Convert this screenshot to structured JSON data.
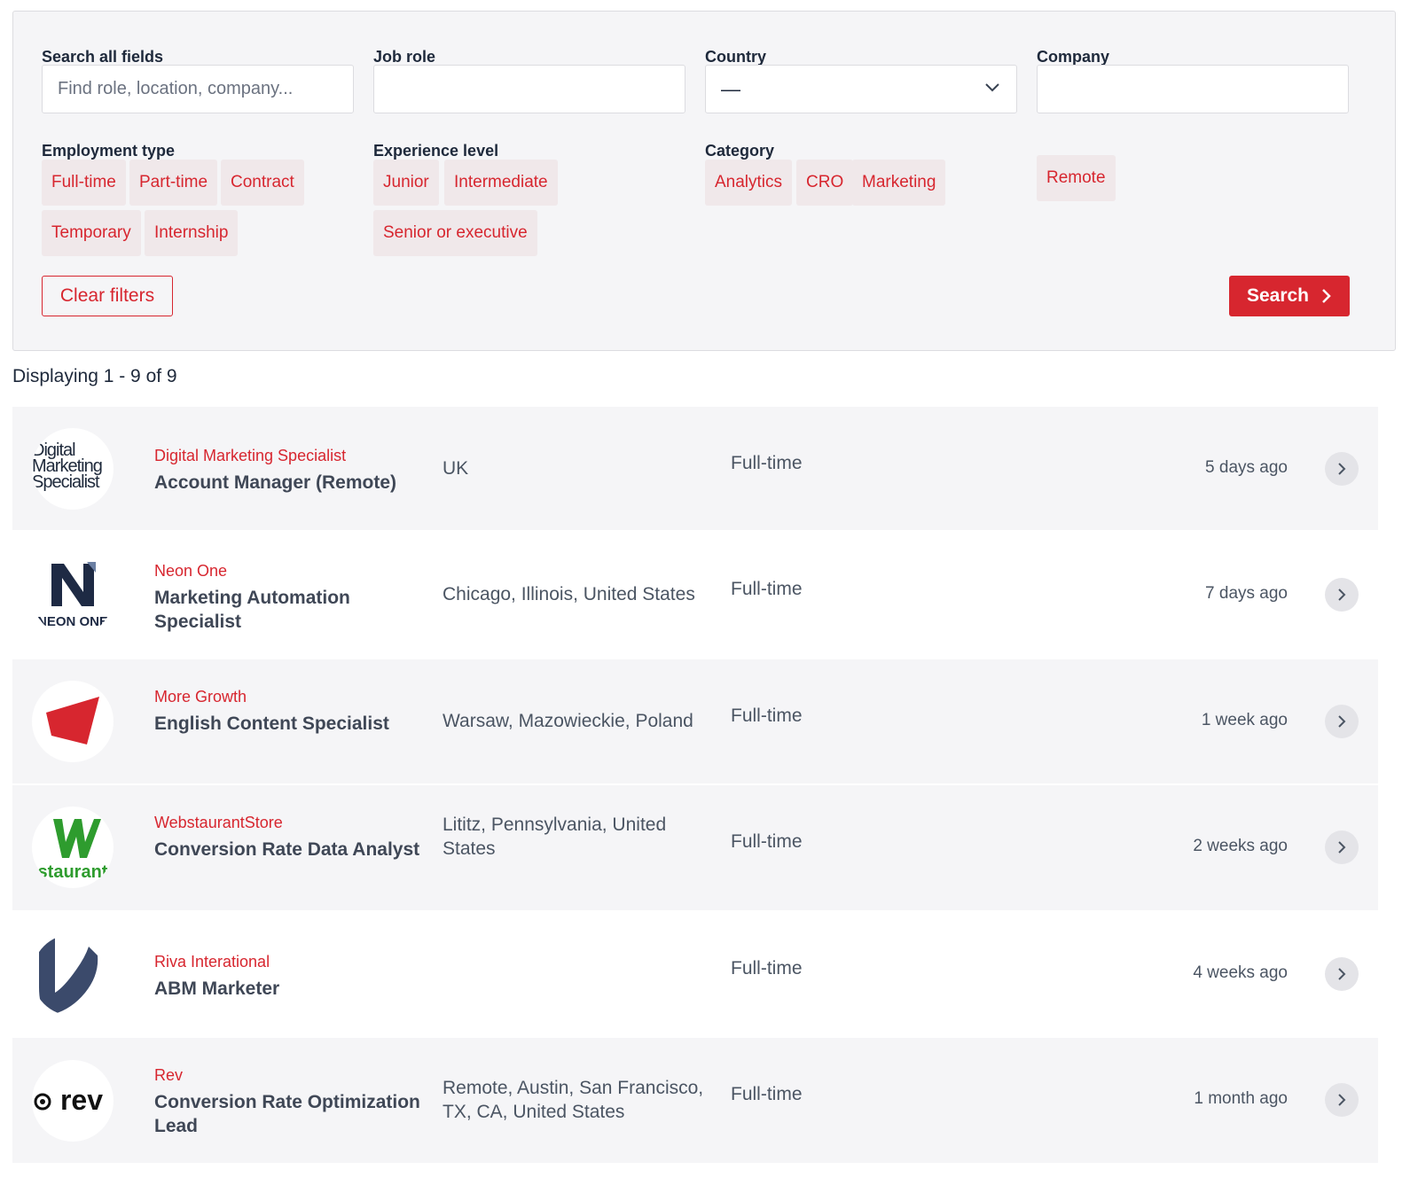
{
  "filters": {
    "search_all": {
      "label": "Search all fields",
      "placeholder": "Find role, location, company..."
    },
    "job_role": {
      "label": "Job role",
      "value": ""
    },
    "country": {
      "label": "Country",
      "value": "—"
    },
    "company": {
      "label": "Company",
      "value": ""
    },
    "employment_type": {
      "label": "Employment type",
      "options": [
        "Full-time",
        "Part-time",
        "Contract",
        "Temporary",
        "Internship"
      ]
    },
    "experience_level": {
      "label": "Experience level",
      "options": [
        "Junior",
        "Intermediate",
        "Senior or executive"
      ]
    },
    "category": {
      "label": "Category",
      "options": [
        "Analytics",
        "CRO",
        "Marketing"
      ]
    },
    "remote_label": "Remote",
    "clear_label": "Clear filters",
    "search_label": "Search"
  },
  "results_count": "Displaying 1 - 9 of 9",
  "jobs": [
    {
      "company": "Digital Marketing Specialist",
      "title": "Account Manager (Remote)",
      "location": "UK",
      "type": "Full-time",
      "posted": "5 days ago",
      "logo_text": [
        "Digital",
        "Marketing",
        "Specialist"
      ]
    },
    {
      "company": "Neon One",
      "title": "Marketing Automation Specialist",
      "location": "Chicago, Illinois, United States",
      "type": "Full-time",
      "posted": "7 days ago",
      "logo_text": "NEON ONE"
    },
    {
      "company": "More Growth",
      "title": "English Content Specialist",
      "location": "Warsaw, Mazowieckie, Poland",
      "type": "Full-time",
      "posted": "1 week ago"
    },
    {
      "company": "WebstaurantStore",
      "title": "Conversion Rate Data Analyst",
      "location": "Lititz, Pennsylvania, United States",
      "type": "Full-time",
      "posted": "2 weeks ago",
      "logo_text": "staurant"
    },
    {
      "company": "Riva Interational",
      "title": "ABM Marketer",
      "location": "",
      "type": "Full-time",
      "posted": "4 weeks ago"
    },
    {
      "company": "Rev",
      "title": "Conversion Rate Optimization Lead",
      "location": "Remote, Austin, San Francisco, TX, CA, United States",
      "type": "Full-time",
      "posted": "1 month ago",
      "logo_text": "rev"
    }
  ],
  "colors": {
    "accent": "#d7262f",
    "chip_bg": "#f0e8ea",
    "panel_bg": "#f5f5f7",
    "text": "#1e293b",
    "muted": "#4b5563"
  }
}
